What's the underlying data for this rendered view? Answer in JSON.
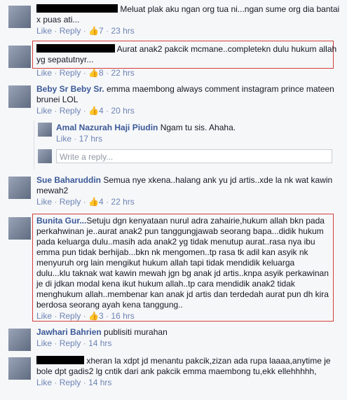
{
  "comments": [
    {
      "text": " Meluat plak aku ngan org tua ni...ngan sume org dia bantai x puas ati...",
      "likes": "7",
      "time": "23 hrs"
    },
    {
      "text": " Aurat anak2 pakcik mcmane..completekn dulu hukum allah yg sepatutnyr...",
      "likes": "8",
      "time": "22 hrs"
    },
    {
      "name": "Beby Sr Beby Sr.",
      "text": " emma maembong always comment instagram prince mateen brunei LOL",
      "likes": "4",
      "time": "20 hrs"
    },
    {
      "name": "Amal Nazurah Haji Piudin",
      "text": " Ngam tu sis. Ahaha.",
      "time": "17 hrs"
    },
    {
      "name": "Sue Baharuddin",
      "text": " Semua nye xkena..halang ank yu jd artis..xde la nk wat kawin mewah2",
      "likes": "4",
      "time": "22 hrs"
    },
    {
      "name": "Bunita Gur...",
      "text": "Setuju dgn kenyataan nurul adra zahairie,hukum allah bkn pada perkahwinan je..aurat anak2 pun tanggungjawab seorang bapa...didik hukum pada keluarga dulu..masih ada anak2 yg tidak menutup aurat..rasa nya ibu emma pun tidak berhijab...bkn nk mengomen..tp rasa tk adil kan asyik nk menyuruh org lain mengikut hukum allah tapi tidak mendidik keluarga dulu...klu taknak wat kawin mewah jgn bg anak jd artis..knpa asyik perkawinan je di jdkan modal kena ikut hukum allah..tp cara mendidik anak2 tidak menghukum allah..membenar kan anak jd artis dan terdedah aurat pun dh kira berdosa seorang ayah kena tanggung..",
      "likes": "3",
      "time": "16 hrs"
    },
    {
      "name": "Jawhari Bahrien",
      "text": " publisiti murahan",
      "time": "14 hrs"
    },
    {
      "text": " xheran la xdpt jd menantu pakcik,zizan ada rupa laaaa,anytime je bole dpt gadis2 lg cntik dari ank pakcik emma maembong tu,ekk ellehhhhh,",
      "time": "14 hrs"
    }
  ],
  "ui": {
    "like": "Like",
    "reply": "Reply",
    "dot": "·",
    "thumb": "👍",
    "write_reply": "Write a reply..."
  }
}
